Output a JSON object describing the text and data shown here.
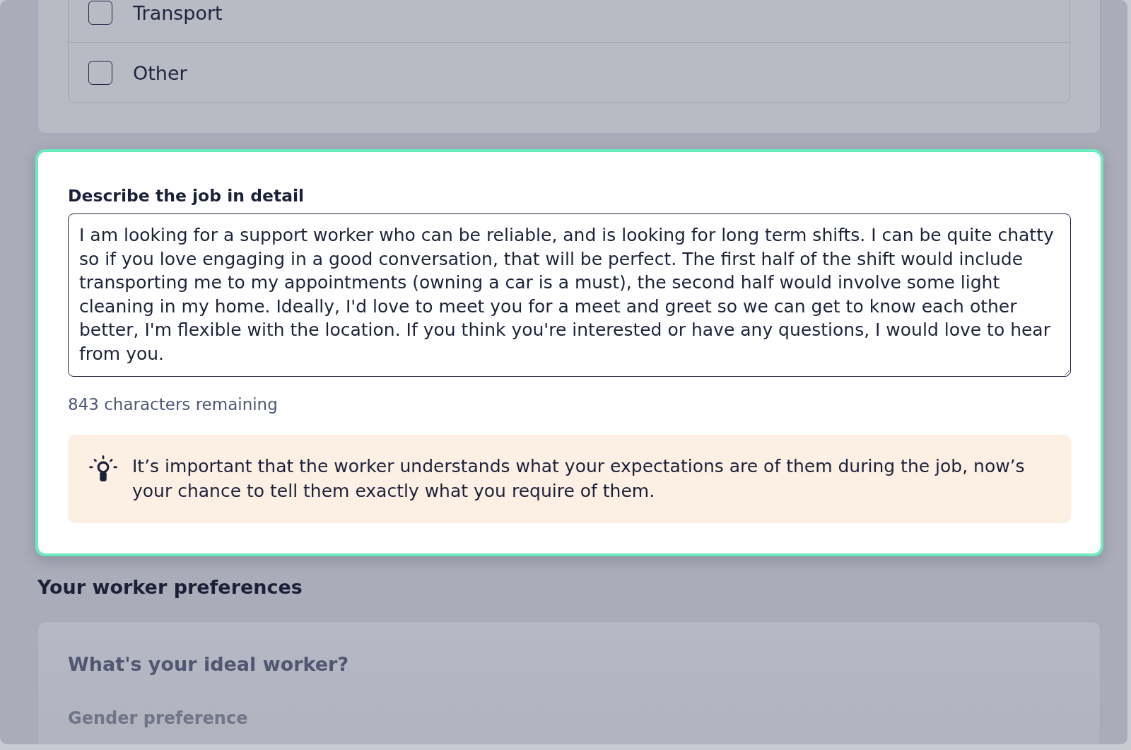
{
  "care_options": [
    {
      "label": "Transport",
      "checked": false
    },
    {
      "label": "Other",
      "checked": false
    }
  ],
  "job_description": {
    "highlighted": true,
    "label": "Describe the job in detail",
    "value": "I am looking for a support worker who can be reliable, and is looking for long term shifts. I can be quite chatty so if you love engaging in a good conversation, that will be perfect. The first half of the shift would include transporting me to my appointments (owning a car is a must), the second half would involve some light cleaning in my home. Ideally, I'd love to meet you for a meet and greet so we can get to know each other better, I'm flexible with the location. If you think you're interested or have any questions, I would love to hear from you.",
    "remaining": "843 characters remaining",
    "tip": "It’s important that the worker understands what your expectations are of them during the job, now’s your chance to tell them exactly what you require of them."
  },
  "worker_preferences": {
    "heading": "Your worker preferences",
    "card_title": "What's your ideal worker?",
    "field_label": "Gender preference"
  }
}
